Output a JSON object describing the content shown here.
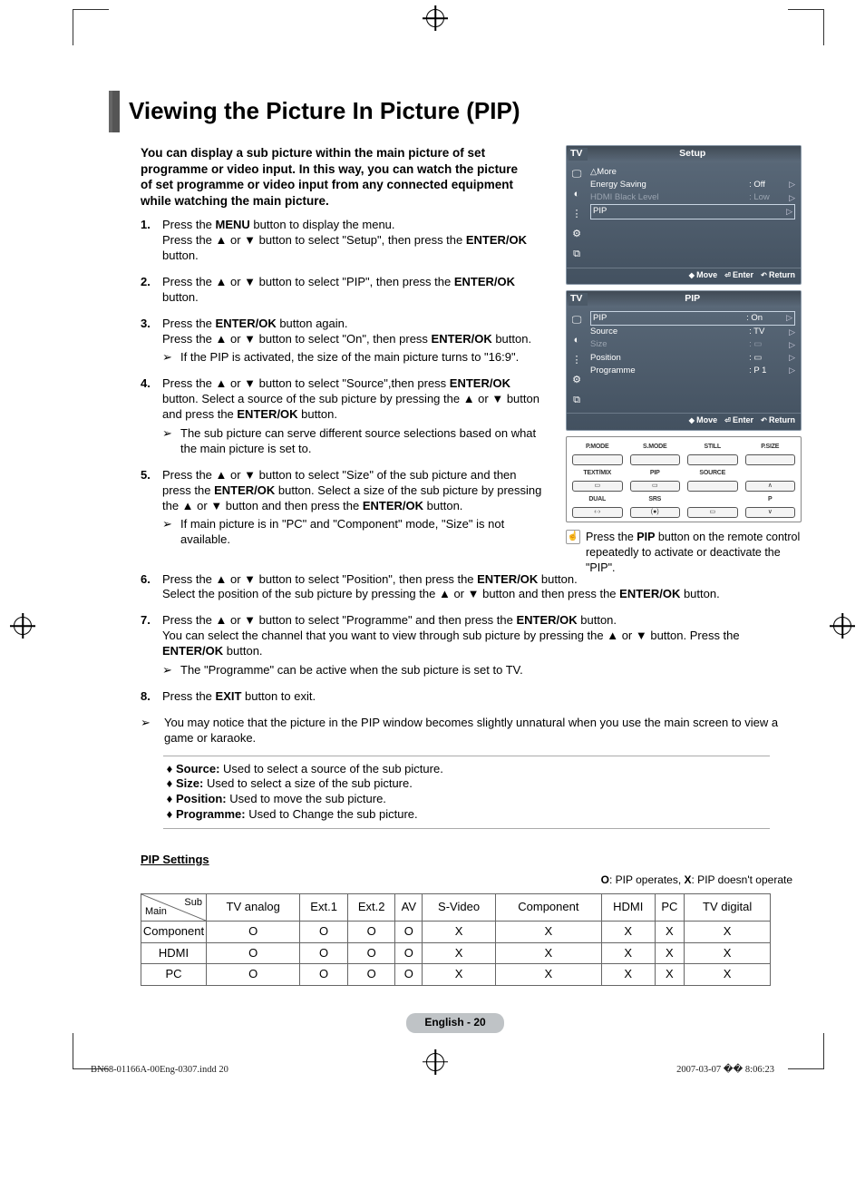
{
  "title": "Viewing the Picture In Picture (PIP)",
  "intro": "You can display a sub picture within the main picture of set programme or video input. In this way, you can watch the picture of set programme or video input from any connected equipment while watching the main picture.",
  "steps": {
    "s1_a": "Press the ",
    "s1_b": "MENU",
    "s1_c": " button to display the menu.\nPress the ▲ or ▼ button to select \"Setup\", then press the ",
    "s1_d": "ENTER/OK",
    "s1_e": " button.",
    "s2_a": "Press the ▲ or ▼ button to select \"PIP\", then press the ",
    "s2_b": "ENTER/OK",
    "s2_c": " button.",
    "s3_a": "Press the ",
    "s3_b": "ENTER/OK",
    "s3_c": " button again.\nPress the ▲ or ▼ button to select \"On\", then press ",
    "s3_d": "ENTER/OK",
    "s3_e": " button.",
    "s3_note": "If the PIP is activated, the size of the main picture turns to \"16:9\".",
    "s4_a": "Press the ▲ or ▼ button to select \"Source\",then press ",
    "s4_b": "ENTER/OK",
    "s4_c": " button. Select a source of the sub picture by pressing the ▲ or ▼ button and press the ",
    "s4_d": "ENTER/OK",
    "s4_e": " button.",
    "s4_note": "The sub picture can serve different source selections based on what the main picture is set to.",
    "s5_a": "Press the ▲ or ▼ button to select \"Size\" of the sub picture and then press the ",
    "s5_b": "ENTER/OK",
    "s5_c": " button. Select a size of the sub picture by pressing the ▲ or ▼ button and then press the ",
    "s5_d": "ENTER/OK",
    "s5_e": " button.",
    "s5_note": "If main picture is in \"PC\" and \"Component\" mode, \"Size\" is not available.",
    "s6_a": "Press the ▲ or ▼ button to select \"Position\", then press the ",
    "s6_b": "ENTER/OK",
    "s6_c": " button.\nSelect the position of the sub picture by pressing the ▲ or ▼ button and then press the ",
    "s6_d": "ENTER/OK",
    "s6_e": " button.",
    "s7_a": "Press the ▲ or ▼ button to select \"Programme\" and then press the ",
    "s7_b": "ENTER/OK",
    "s7_c": " button.\nYou can select the channel that you want to view through sub picture by pressing the ▲ or ▼ button. Press the ",
    "s7_d": "ENTER/OK",
    "s7_e": " button.",
    "s7_note": "The \"Programme\" can be active when the sub picture is set to TV.",
    "s8_a": "Press the ",
    "s8_b": "EXIT",
    "s8_c": " button to exit."
  },
  "final_note": "You may notice that the picture in the PIP window becomes slightly unnatural when you use the main screen to view a game or karaoke.",
  "defs": {
    "source_k": "Source:",
    "source_v": " Used to select a source of the sub picture.",
    "size_k": "Size:",
    "size_v": " Used to select a size of the sub picture.",
    "position_k": "Position:",
    "position_v": " Used to move the sub picture.",
    "programme_k": "Programme:",
    "programme_v": " Used to Change the sub picture."
  },
  "osd1": {
    "left": "TV",
    "title": "Setup",
    "more": "△More",
    "energy_k": "Energy Saving",
    "energy_v": ": Off",
    "hdmi_k": "HDMI Black Level",
    "hdmi_v": ": Low",
    "pip_k": "PIP",
    "foot_move": "Move",
    "foot_enter": "Enter",
    "foot_return": "Return"
  },
  "osd2": {
    "left": "TV",
    "title": "PIP",
    "pip_k": "PIP",
    "pip_v": ": On",
    "source_k": "Source",
    "source_v": ": TV",
    "size_k": "Size",
    "size_v": ":",
    "position_k": "Position",
    "position_v": ":",
    "programme_k": "Programme",
    "programme_v": ": P 1",
    "foot_move": "Move",
    "foot_enter": "Enter",
    "foot_return": "Return"
  },
  "remote": {
    "r1": [
      "P.MODE",
      "S.MODE",
      "STILL",
      "P.SIZE"
    ],
    "r2": [
      "TEXT/MIX",
      "PIP",
      "SOURCE",
      ""
    ],
    "r3": [
      "DUAL",
      "SRS",
      "",
      ""
    ]
  },
  "remote_note_a": "Press the ",
  "remote_note_b": "PIP",
  "remote_note_c": " button on the remote control repeatedly to activate or deactivate the \"PIP\".",
  "pip_settings_label": "PIP Settings",
  "table_note_o": "O",
  "table_note_o_t": ": PIP operates, ",
  "table_note_x": "X",
  "table_note_x_t": ": PIP doesn't operate",
  "table": {
    "diag_sub": "Sub",
    "diag_main": "Main",
    "cols": [
      "TV analog",
      "Ext.1",
      "Ext.2",
      "AV",
      "S-Video",
      "Component",
      "HDMI",
      "PC",
      "TV digital"
    ],
    "rows": [
      {
        "h": "Component",
        "c": [
          "O",
          "O",
          "O",
          "O",
          "X",
          "X",
          "X",
          "X",
          "X"
        ]
      },
      {
        "h": "HDMI",
        "c": [
          "O",
          "O",
          "O",
          "O",
          "X",
          "X",
          "X",
          "X",
          "X"
        ]
      },
      {
        "h": "PC",
        "c": [
          "O",
          "O",
          "O",
          "O",
          "X",
          "X",
          "X",
          "X",
          "X"
        ]
      }
    ]
  },
  "page_foot": "English - 20",
  "print_left": "BN68-01166A-00Eng-0307.indd   20",
  "print_right": "2007-03-07   �� 8:06:23"
}
